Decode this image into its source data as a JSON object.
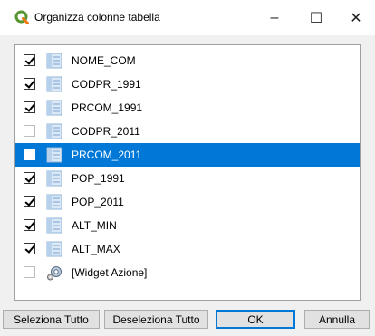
{
  "window": {
    "title": "Organizza colonne tabella",
    "minimize_label": "–",
    "maximize_label": "☐",
    "close_label": "✕"
  },
  "columns": [
    {
      "label": "NOME_COM",
      "checked": true,
      "selected": false,
      "icon": "table-field-icon"
    },
    {
      "label": "CODPR_1991",
      "checked": true,
      "selected": false,
      "icon": "table-field-icon"
    },
    {
      "label": "PRCOM_1991",
      "checked": true,
      "selected": false,
      "icon": "table-field-icon"
    },
    {
      "label": "CODPR_2011",
      "checked": false,
      "selected": false,
      "icon": "table-field-icon"
    },
    {
      "label": "PRCOM_2011",
      "checked": false,
      "selected": true,
      "icon": "table-field-icon"
    },
    {
      "label": "POP_1991",
      "checked": true,
      "selected": false,
      "icon": "table-field-icon"
    },
    {
      "label": "POP_2011",
      "checked": true,
      "selected": false,
      "icon": "table-field-icon"
    },
    {
      "label": "ALT_MIN",
      "checked": true,
      "selected": false,
      "icon": "table-field-icon"
    },
    {
      "label": "ALT_MAX",
      "checked": true,
      "selected": false,
      "icon": "table-field-icon"
    },
    {
      "label": "[Widget Azione]",
      "checked": false,
      "selected": false,
      "icon": "action-widget-icon"
    }
  ],
  "buttons": {
    "select_all": "Seleziona Tutto",
    "deselect_all": "Deseleziona Tutto",
    "ok": "OK",
    "cancel": "Annulla"
  },
  "colors": {
    "selection": "#0078d7",
    "qgis_green": "#589632",
    "qgis_yellow": "#ee7913"
  }
}
